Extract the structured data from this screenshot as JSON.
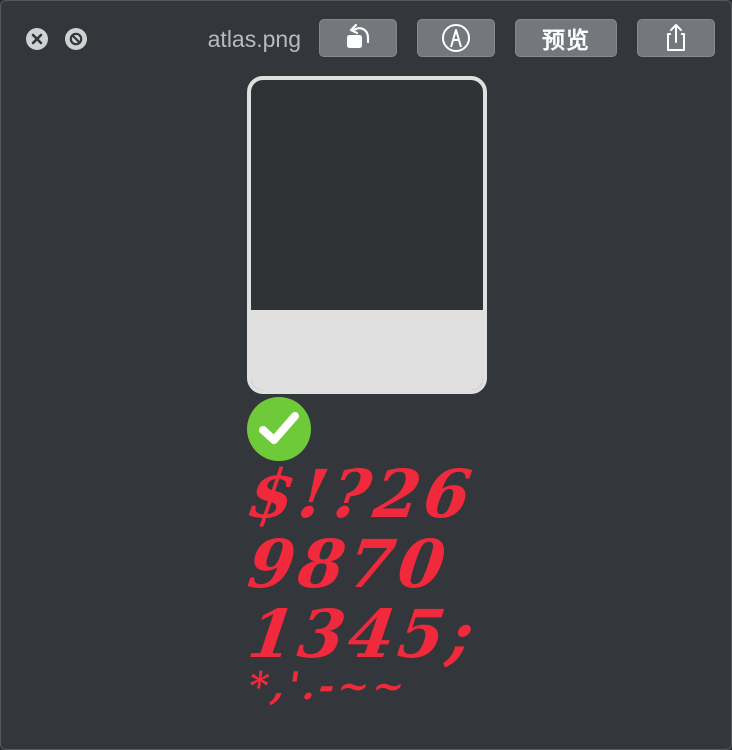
{
  "window": {
    "title": "atlas.png",
    "controls": {
      "close_icon": "close-circle-x",
      "fullscreen_icon": "disabled-circle"
    }
  },
  "toolbar": {
    "rotate_icon": "rotate-left",
    "markup_icon": "markup-pen-circle",
    "preview_label": "预览",
    "share_icon": "share-up-arrow"
  },
  "content": {
    "thumbnail_icon": "image-card",
    "status_icon": "green-checkmark",
    "glyph_rows": [
      "$!?26",
      "9870",
      "1345;",
      "*,'.-~~"
    ]
  },
  "colors": {
    "background": "#33363a",
    "button": "#74777b",
    "glyph": "#f02a3c",
    "check": "#6fca3a",
    "card": "#e0e0e0"
  }
}
